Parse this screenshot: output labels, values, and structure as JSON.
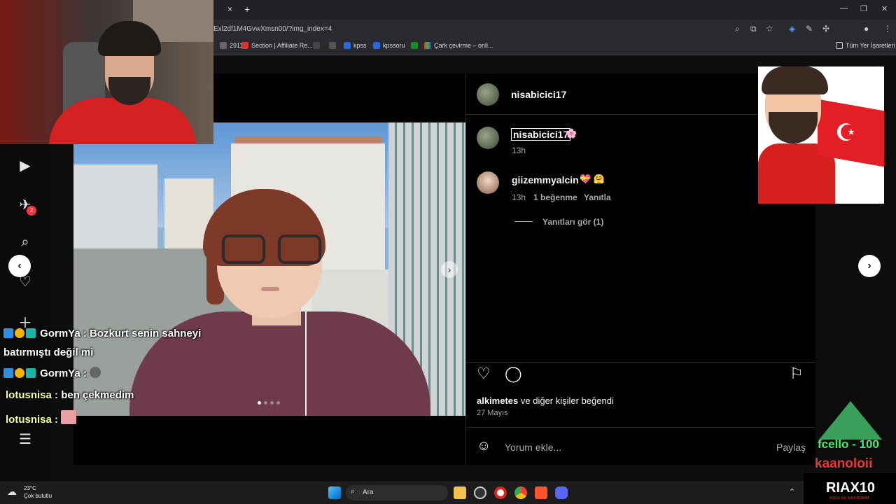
{
  "browser": {
    "url": "Exl2df1M4GvwXmsn00/?img_index=4",
    "bookmarks": [
      "2911",
      "Section | Affiliate Re...",
      "kpss",
      "kpssoru",
      "Çark çevirme – onli..."
    ],
    "bookmarks_folder": "Tüm Yer İşaretleri",
    "new_tab": "+",
    "tab_close": "×"
  },
  "post": {
    "author": "nisabicici17",
    "caption_user": "nisabicici17",
    "caption_emoji": "🌸",
    "caption_time": "13h",
    "comment": {
      "user": "giizemmyalcin",
      "emoji": "💝 🤗",
      "time": "13h",
      "likes": "1 beğenme",
      "reply": "Yanıtla",
      "view_replies": "Yanıtları gör (1)"
    },
    "liked_by_user": "alkimetes",
    "liked_by_rest": " ve diğer kişiler beğendi",
    "date": "27 Mayıs",
    "comment_placeholder": "Yorum ekle...",
    "share": "Paylaş"
  },
  "stream_chat": [
    {
      "user": "GormYa",
      "text": " : Bozkurt senin sahneyi"
    },
    {
      "user": "",
      "text": "batırmıştı değil mi"
    },
    {
      "user": "GormYa",
      "text": " :"
    },
    {
      "user": "lotusnisa",
      "text": " : ben çekmedim"
    },
    {
      "user": "lotusnisa",
      "text": " :"
    }
  ],
  "overlay": {
    "drop_name": "fcello - 100",
    "drop_name2": "kaanoloii",
    "brand": "RIAX10",
    "brand_sub": "KODU İLE %10 İNDİRİM"
  },
  "taskbar": {
    "search": "Ara",
    "temp": "23°C",
    "weather": "Çok bulutlu"
  },
  "notification_count": "2",
  "icons": [
    "close-icon",
    "arrow-left-icon",
    "arrow-right-icon",
    "heart-icon",
    "comment-icon",
    "bookmark-icon",
    "emoji-icon",
    "search-icon",
    "reels-icon",
    "messages-icon"
  ],
  "colors": {
    "accent": "#0095f6",
    "panel_bg": "#000000",
    "muted": "#a8a8a8"
  }
}
